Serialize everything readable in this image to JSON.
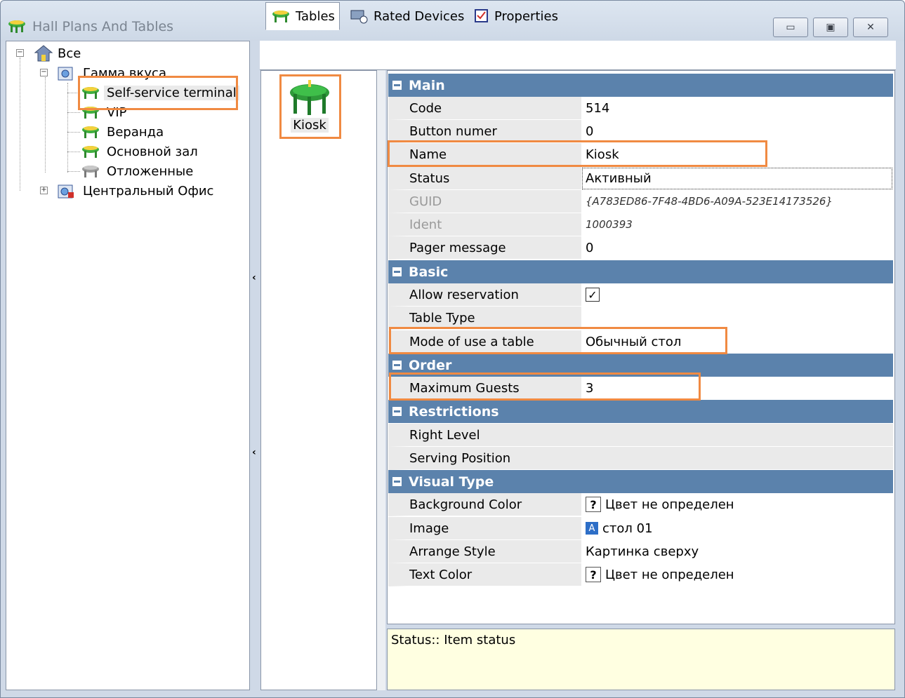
{
  "window": {
    "title": "Hall Plans And Tables"
  },
  "tree": {
    "root": "Все",
    "group1": "Гамма вкуса",
    "items": [
      {
        "label": "Self-service terminal"
      },
      {
        "label": "VIP"
      },
      {
        "label": "Веранда"
      },
      {
        "label": "Основной зал"
      },
      {
        "label": "Отложенные"
      }
    ],
    "group2": "Центральный Офис"
  },
  "tabs": [
    {
      "label": "Tables"
    },
    {
      "label": "Rated Devices"
    },
    {
      "label": "Properties"
    }
  ],
  "tables_list": {
    "item_label": "Kiosk"
  },
  "properties": {
    "main": {
      "title": "Main"
    },
    "code": {
      "name": "Code",
      "value": "514"
    },
    "button_numer": {
      "name": "Button numer",
      "value": "0"
    },
    "name": {
      "name": "Name",
      "value": "Kiosk"
    },
    "status": {
      "name": "Status",
      "value": "Активный"
    },
    "guid": {
      "name": "GUID",
      "value": "{A783ED86-7F48-4BD6-A09A-523E14173526}"
    },
    "ident": {
      "name": "Ident",
      "value": "1000393"
    },
    "pager": {
      "name": "Pager message",
      "value": "0"
    },
    "basic": {
      "title": "Basic"
    },
    "allow_reservation": {
      "name": "Allow reservation",
      "checked": true
    },
    "table_type": {
      "name": "Table Type",
      "value": ""
    },
    "mode": {
      "name": "Mode of use a table",
      "value": "Обычный стол"
    },
    "order": {
      "title": "Order"
    },
    "max_guests": {
      "name": "Maximum Guests",
      "value": "3"
    },
    "restrictions": {
      "title": "Restrictions"
    },
    "right_level": {
      "name": "Right Level",
      "value": ""
    },
    "serving_position": {
      "name": "Serving Position",
      "value": ""
    },
    "visual_type": {
      "title": "Visual Type"
    },
    "background_color": {
      "name": "Background Color",
      "value": "Цвет не определен"
    },
    "image": {
      "name": "Image",
      "value": "стол 01"
    },
    "arrange_style": {
      "name": "Arrange Style",
      "value": "Картинка сверху"
    },
    "text_color": {
      "name": "Text Color",
      "value": "Цвет не определен"
    }
  },
  "description": {
    "text": "Status:: Item status"
  },
  "colors": {
    "category_header": "#5b82ac",
    "highlight": "#f08a42",
    "description_bg": "#ffffe1"
  }
}
